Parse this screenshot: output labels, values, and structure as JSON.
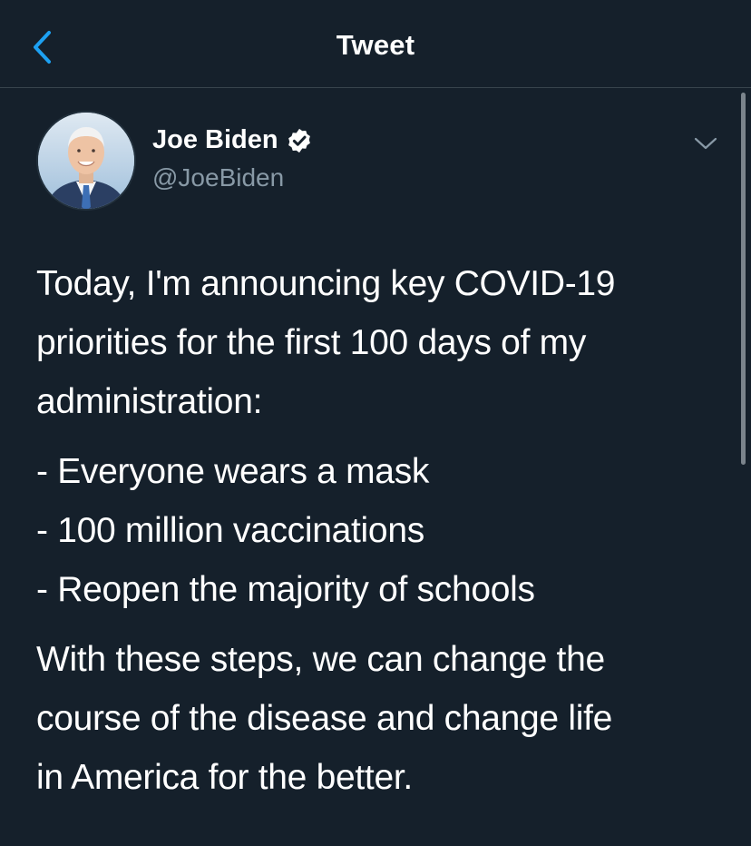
{
  "header": {
    "title": "Tweet",
    "back_icon": "chevron-left-icon",
    "accent_color": "#1da1f2"
  },
  "author": {
    "name": "Joe Biden",
    "handle": "@JoeBiden",
    "verified_icon": "verified-badge-icon",
    "more_icon": "chevron-down-icon"
  },
  "tweet": {
    "intro_lines": [
      "Today, I'm announcing key COVID-19",
      "priorities for the first 100 days of my",
      "administration:"
    ],
    "list_lines": [
      "- Everyone wears a mask",
      "- 100 million vaccinations",
      "- Reopen the majority of schools"
    ],
    "closing_lines": [
      "With these steps, we can change the",
      "course of the disease and change life",
      "in America for the better."
    ]
  },
  "colors": {
    "background": "#15202b",
    "text": "#ffffff",
    "secondary_text": "#8899a6",
    "divider": "#38444d"
  }
}
